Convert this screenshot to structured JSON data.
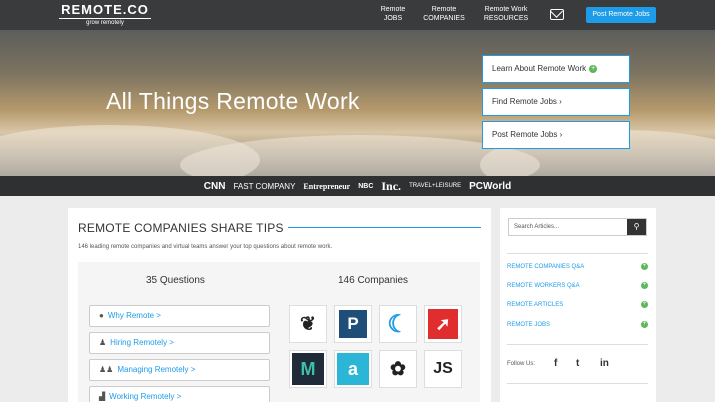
{
  "header": {
    "logo": "REMOTE.CO",
    "tagline": "grow remotely",
    "nav": [
      {
        "line1": "Remote",
        "line2": "JOBS"
      },
      {
        "line1": "Remote",
        "line2": "COMPANIES"
      },
      {
        "line1": "Remote Work",
        "line2": "RESOURCES"
      }
    ],
    "post_button": "Post Remote Jobs"
  },
  "hero": {
    "title": "All Things Remote Work",
    "buttons": [
      "Learn About Remote Work",
      "Find Remote Jobs",
      "Post Remote Jobs"
    ]
  },
  "press": [
    "CNN",
    "FAST COMPANY",
    "Entrepreneur",
    "NBC",
    "Inc.",
    "TRAVEL+LEISURE",
    "PCWorld"
  ],
  "main": {
    "heading": "REMOTE COMPANIES SHARE TIPS",
    "subtitle": "146 leading remote companies and virtual teams answer your top questions about remote work.",
    "questions_header": "35 Questions",
    "companies_header": "146 Companies",
    "questions": [
      "Why Remote >",
      "Hiring Remotely >",
      "Managing Remotely >",
      "Working Remotely >"
    ]
  },
  "sidebar": {
    "search_placeholder": "Search Articles...",
    "links": [
      "REMOTE COMPANIES Q&A",
      "REMOTE WORKERS Q&A",
      "REMOTE ARTICLES",
      "REMOTE JOBS"
    ],
    "follow_label": "Follow Us:",
    "social": [
      "f",
      "t",
      "in"
    ]
  },
  "colors": {
    "accent": "#1e9ce8",
    "dark": "#3a3b3d",
    "green": "#5cb85c"
  }
}
